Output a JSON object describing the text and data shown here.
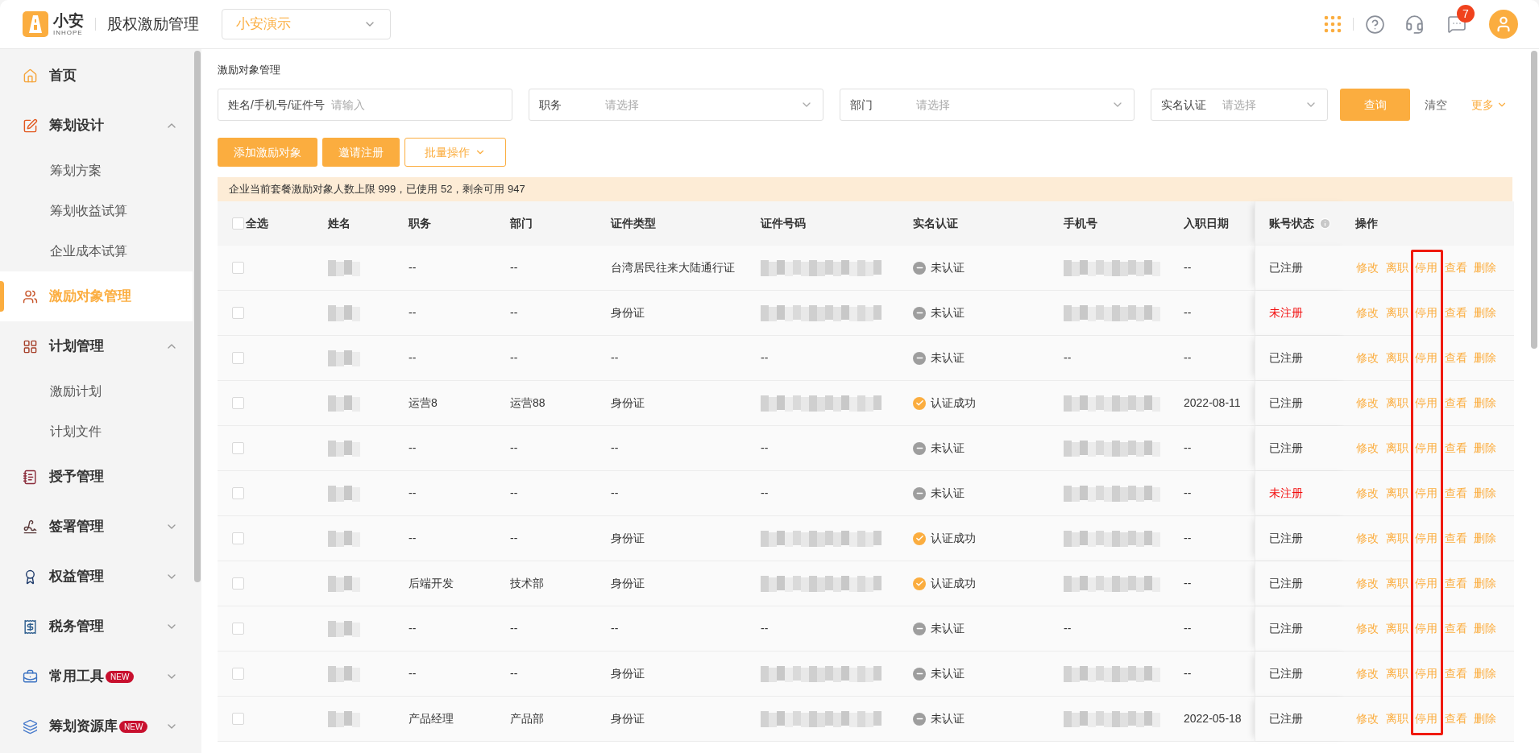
{
  "header": {
    "logo_text": "小安",
    "logo_sub": "INHOPE",
    "app_title": "股权激励管理",
    "company_select": "小安演示",
    "notification_count": "7"
  },
  "sidebar": {
    "items": [
      {
        "label": "首页",
        "selected": false
      },
      {
        "label": "筹划设计",
        "selected": false,
        "expanded": true,
        "children": [
          {
            "label": "筹划方案",
            "selected": false
          },
          {
            "label": "筹划收益试算",
            "selected": false
          },
          {
            "label": "企业成本试算",
            "selected": false
          }
        ]
      },
      {
        "label": "激励对象管理",
        "selected": true
      },
      {
        "label": "计划管理",
        "selected": false,
        "expanded": true,
        "children": [
          {
            "label": "激励计划",
            "selected": false
          },
          {
            "label": "计划文件",
            "selected": false
          }
        ]
      },
      {
        "label": "授予管理",
        "selected": false
      },
      {
        "label": "签署管理",
        "selected": false,
        "expanded": false
      },
      {
        "label": "权益管理",
        "selected": false,
        "expanded": false
      },
      {
        "label": "税务管理",
        "selected": false,
        "expanded": false
      },
      {
        "label": "常用工具",
        "selected": false,
        "expanded": false,
        "badge": "NEW"
      },
      {
        "label": "筹划资源库",
        "selected": false,
        "expanded": false,
        "badge": "NEW"
      }
    ]
  },
  "page_title": "激励对象管理",
  "filters": [
    {
      "kind": "input",
      "label": "姓名/手机号/证件号",
      "placeholder": "请输入"
    },
    {
      "kind": "select",
      "label": "职务",
      "placeholder": "请选择"
    },
    {
      "kind": "select",
      "label": "部门",
      "placeholder": "请选择"
    },
    {
      "kind": "select",
      "label": "实名认证",
      "placeholder": "请选择"
    }
  ],
  "filter_actions": {
    "search": "查询",
    "clear": "清空",
    "more": "更多"
  },
  "toolbar": [
    {
      "kind": "primary",
      "label": "添加激励对象"
    },
    {
      "kind": "primary",
      "label": "邀请注册"
    },
    {
      "kind": "dropdown",
      "label": "批量操作"
    }
  ],
  "notice": "企业当前套餐激励对象人数上限 999，已使用 52，剩余可用 947",
  "table": {
    "select_all": {
      "label": "全选",
      "checked": false
    },
    "columns": [
      {
        "label": "姓名"
      },
      {
        "label": "职务"
      },
      {
        "label": "部门"
      },
      {
        "label": "证件类型"
      },
      {
        "label": "证件号码"
      },
      {
        "label": "实名认证"
      },
      {
        "label": "手机号"
      },
      {
        "label": "入职日期"
      },
      {
        "label": "账号状态",
        "info": true
      },
      {
        "label": "操作"
      }
    ],
    "rows": [
      {
        "checked": false,
        "name_redacted": true,
        "position": "--",
        "department": "--",
        "id_type": "台湾居民往来大陆通行证",
        "id_number_redacted": true,
        "verification": {
          "label": "未认证",
          "verified": false
        },
        "phone_redacted": true,
        "hire_date": "--",
        "account_status": {
          "label": "已注册",
          "registered": true
        },
        "actions": [
          "修改",
          "离职",
          "停用",
          "查看",
          "删除"
        ]
      },
      {
        "checked": false,
        "name_redacted": true,
        "position": "--",
        "department": "--",
        "id_type": "身份证",
        "id_number_redacted": true,
        "verification": {
          "label": "未认证",
          "verified": false
        },
        "phone_redacted": true,
        "hire_date": "--",
        "account_status": {
          "label": "未注册",
          "registered": false
        },
        "actions": [
          "修改",
          "离职",
          "停用",
          "查看",
          "删除"
        ]
      },
      {
        "checked": false,
        "name_redacted": true,
        "position": "--",
        "department": "--",
        "id_type": "--",
        "id_number": "--",
        "verification": {
          "label": "未认证",
          "verified": false
        },
        "phone": "--",
        "hire_date": "--",
        "account_status": {
          "label": "已注册",
          "registered": true
        },
        "actions": [
          "修改",
          "离职",
          "停用",
          "查看",
          "删除"
        ]
      },
      {
        "checked": false,
        "name_redacted": true,
        "position": "运营8",
        "department": "运营88",
        "id_type": "身份证",
        "id_number_redacted": true,
        "verification": {
          "label": "认证成功",
          "verified": true
        },
        "phone_redacted": true,
        "hire_date": "2022-08-11",
        "account_status": {
          "label": "已注册",
          "registered": true
        },
        "actions": [
          "修改",
          "离职",
          "停用",
          "查看",
          "删除"
        ]
      },
      {
        "checked": false,
        "name_redacted": true,
        "position": "--",
        "department": "--",
        "id_type": "--",
        "id_number": "--",
        "verification": {
          "label": "未认证",
          "verified": false
        },
        "phone_redacted": true,
        "hire_date": "--",
        "account_status": {
          "label": "已注册",
          "registered": true
        },
        "actions": [
          "修改",
          "离职",
          "停用",
          "查看",
          "删除"
        ]
      },
      {
        "checked": false,
        "name_redacted": true,
        "position": "--",
        "department": "--",
        "id_type": "--",
        "id_number": "--",
        "verification": {
          "label": "未认证",
          "verified": false
        },
        "phone_redacted": true,
        "hire_date": "--",
        "account_status": {
          "label": "未注册",
          "registered": false
        },
        "actions": [
          "修改",
          "离职",
          "停用",
          "查看",
          "删除"
        ]
      },
      {
        "checked": false,
        "name_redacted": true,
        "position": "--",
        "department": "--",
        "id_type": "身份证",
        "id_number_redacted": true,
        "verification": {
          "label": "认证成功",
          "verified": true
        },
        "phone_redacted": true,
        "hire_date": "--",
        "account_status": {
          "label": "已注册",
          "registered": true
        },
        "actions": [
          "修改",
          "离职",
          "停用",
          "查看",
          "删除"
        ]
      },
      {
        "checked": false,
        "name_redacted": true,
        "position": "后端开发",
        "department": "技术部",
        "id_type": "身份证",
        "id_number_redacted": true,
        "verification": {
          "label": "认证成功",
          "verified": true
        },
        "phone_redacted": true,
        "hire_date": "--",
        "account_status": {
          "label": "已注册",
          "registered": true
        },
        "actions": [
          "修改",
          "离职",
          "停用",
          "查看",
          "删除"
        ]
      },
      {
        "checked": false,
        "name_redacted": true,
        "position": "--",
        "department": "--",
        "id_type": "--",
        "id_number": "--",
        "verification": {
          "label": "未认证",
          "verified": false
        },
        "phone": "--",
        "hire_date": "--",
        "account_status": {
          "label": "已注册",
          "registered": true
        },
        "actions": [
          "修改",
          "离职",
          "停用",
          "查看",
          "删除"
        ]
      },
      {
        "checked": false,
        "name_redacted": true,
        "position": "--",
        "department": "--",
        "id_type": "身份证",
        "id_number_redacted": true,
        "verification": {
          "label": "未认证",
          "verified": false
        },
        "phone_redacted": true,
        "hire_date": "--",
        "account_status": {
          "label": "已注册",
          "registered": true
        },
        "actions": [
          "修改",
          "离职",
          "停用",
          "查看",
          "删除"
        ]
      },
      {
        "checked": false,
        "name_redacted": true,
        "position": "产品经理",
        "department": "产品部",
        "id_type": "身份证",
        "id_number_redacted": true,
        "verification": {
          "label": "未认证",
          "verified": false
        },
        "phone_redacted": true,
        "hire_date": "2022-05-18",
        "account_status": {
          "label": "已注册",
          "registered": true
        },
        "actions": [
          "修改",
          "离职",
          "停用",
          "查看",
          "删除"
        ]
      }
    ]
  },
  "annotation": {
    "kind": "highlight"
  }
}
